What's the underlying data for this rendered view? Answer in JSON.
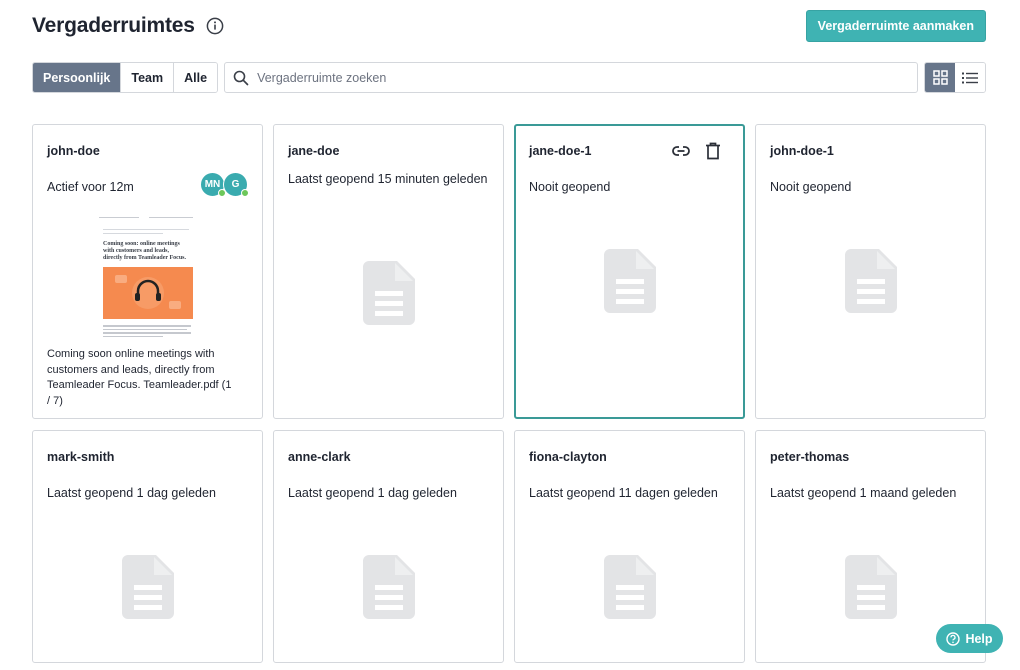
{
  "header": {
    "title": "Vergaderruimtes",
    "create_label": "Vergaderruimte aanmaken"
  },
  "toolbar": {
    "filters": [
      "Persoonlijk",
      "Team",
      "Alle"
    ],
    "active_filter": "Persoonlijk",
    "search_placeholder": "Vergaderruimte zoeken",
    "search_value": "",
    "active_view": "grid"
  },
  "rooms": [
    {
      "name": "john-doe",
      "status": "Actief voor 12m",
      "avatars": [
        "MN",
        "G"
      ],
      "thumbnail": {
        "heading": "Coming soon: online meetings with customers and leads, directly from Teamleader Focus.",
        "caption": "Coming soon online meetings with customers and leads, directly from Teamleader Focus. Teamleader.pdf (1 / 7)"
      }
    },
    {
      "name": "jane-doe",
      "status": "Laatst geopend 15 minuten geleden"
    },
    {
      "name": "jane-doe-1",
      "status": "Nooit geopend",
      "selected": true
    },
    {
      "name": "john-doe-1",
      "status": "Nooit geopend"
    },
    {
      "name": "mark-smith",
      "status": "Laatst geopend 1 dag geleden"
    },
    {
      "name": "anne-clark",
      "status": "Laatst geopend 1 dag geleden"
    },
    {
      "name": "fiona-clayton",
      "status": "Laatst geopend 11 dagen geleden"
    },
    {
      "name": "peter-thomas",
      "status": "Laatst geopend 1 maand geleden"
    }
  ],
  "help": {
    "label": "Help"
  },
  "colors": {
    "accent": "#3fb3b3",
    "active_segment": "#67758a",
    "selected_border": "#3a9a97",
    "online_dot": "#6dc75a"
  }
}
